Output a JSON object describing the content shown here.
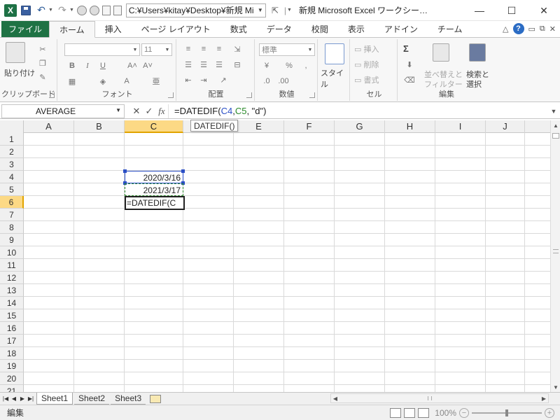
{
  "titlebar": {
    "path_value": "C:¥Users¥kitay¥Desktop¥新規 Mi",
    "window_title": "新規 Microsoft Excel ワークシー…",
    "minimize": "―",
    "maximize": "☐",
    "close": "✕"
  },
  "tabs": {
    "file": "ファイル",
    "home": "ホーム",
    "insert": "挿入",
    "page_layout": "ページ レイアウト",
    "formulas": "数式",
    "data": "データ",
    "review": "校閲",
    "view": "表示",
    "addins": "アドイン",
    "team": "チーム"
  },
  "ribbon": {
    "clipboard": {
      "label": "クリップボード",
      "paste": "貼り付け"
    },
    "font": {
      "label": "フォント",
      "size": "11",
      "bold": "B",
      "italic": "I",
      "underline": "U"
    },
    "alignment": {
      "label": "配置"
    },
    "number": {
      "label": "数値",
      "format": "標準",
      "percent": "%",
      "comma": ","
    },
    "style": {
      "label": "スタイル"
    },
    "cells": {
      "label": "セル",
      "insert": "挿入",
      "delete": "削除",
      "format": "書式"
    },
    "editing": {
      "label": "編集",
      "sum": "Σ",
      "sort_filter_1": "並べ替えと",
      "sort_filter_2": "フィルター",
      "find_select_1": "検索と",
      "find_select_2": "選択"
    }
  },
  "formula_bar": {
    "name_box": "AVERAGE",
    "cancel": "✕",
    "enter": "✓",
    "fx": "fx",
    "formula_prefix": "=DATEDIF(",
    "formula_ref1": "C4",
    "formula_comma": ",",
    "formula_ref2": "C5",
    "formula_suffix": ", \"d\")",
    "tooltip": "DATEDIF()"
  },
  "grid": {
    "columns": [
      "A",
      "B",
      "C",
      "D",
      "E",
      "F",
      "G",
      "H",
      "I",
      "J"
    ],
    "rows": [
      "1",
      "2",
      "3",
      "4",
      "5",
      "6",
      "7",
      "8",
      "9",
      "10",
      "11",
      "12",
      "13",
      "14",
      "15",
      "16",
      "17",
      "18",
      "19",
      "20",
      "21"
    ],
    "selected_column": "C",
    "selected_row": "6",
    "cells": {
      "C4": "2020/3/16",
      "C5": "2021/3/17",
      "C6": "=DATEDIF(C"
    }
  },
  "sheets": {
    "tabs": [
      "Sheet1",
      "Sheet2",
      "Sheet3"
    ],
    "active": "Sheet1"
  },
  "statusbar": {
    "mode": "編集",
    "zoom": "100%"
  },
  "colors": {
    "excel_green": "#1f7244",
    "header_selected": "#fcd985",
    "ref_blue": "#2b4fc6",
    "ref_green": "#2a8a2a"
  }
}
